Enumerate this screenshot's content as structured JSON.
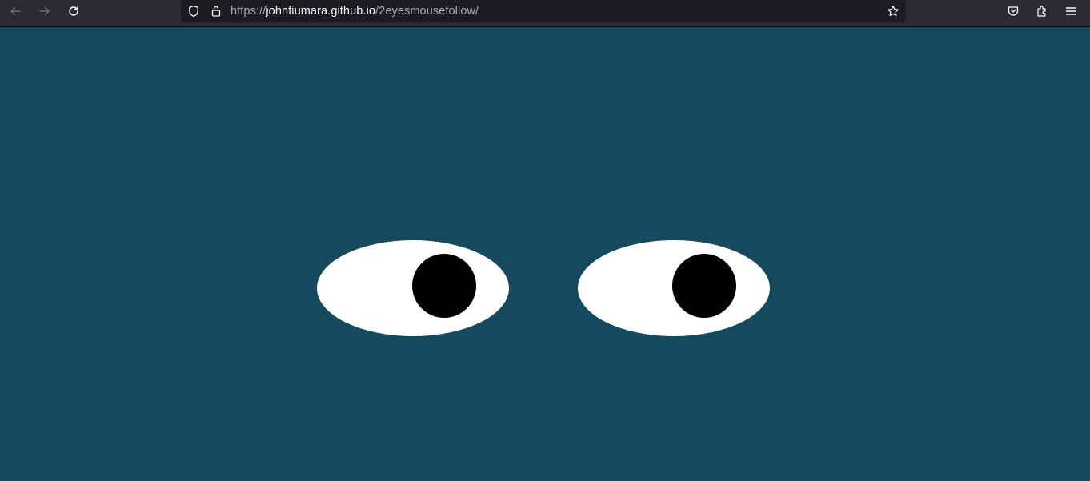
{
  "browser": {
    "url_scheme": "https://",
    "url_host": "johnfiumara.github.io",
    "url_path": "/2eyesmousefollow/",
    "toolbar_icons": [
      "back-arrow-icon",
      "forward-arrow-icon",
      "reload-icon",
      "shield-icon",
      "lock-icon",
      "star-icon",
      "pocket-icon",
      "extensions-icon",
      "menu-icon"
    ],
    "colors": {
      "toolbar": "#2b2a33",
      "urlbar": "#1c1b22",
      "icon": "#fbfbfe",
      "icon_disabled": "#6b6b72"
    }
  },
  "page": {
    "background": "#16485e",
    "eye_color": "#ffffff",
    "pupil_color": "#000000"
  }
}
